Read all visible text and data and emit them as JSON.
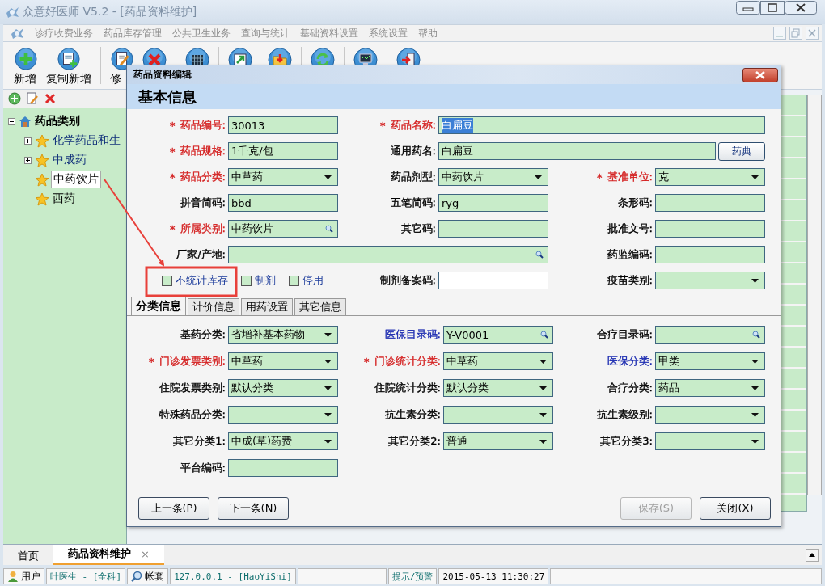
{
  "window": {
    "title": "众意好医师 V5.2 - [药品资料维护]"
  },
  "menu": [
    {
      "label": "诊疗收费业务"
    },
    {
      "label": "药品库存管理"
    },
    {
      "label": "公共卫生业务"
    },
    {
      "label": "查询与统计"
    },
    {
      "label": "基础资料设置"
    },
    {
      "label": "系统设置"
    },
    {
      "label": "帮助"
    }
  ],
  "toolbar": {
    "buttons": [
      {
        "label": "新增"
      },
      {
        "label": "复制新增"
      },
      {
        "label": "修"
      }
    ]
  },
  "tree": {
    "label": "药品类别",
    "expanded": true,
    "selected": false,
    "children": [
      {
        "label": "化学药品和生",
        "expanded": false,
        "selected": false
      },
      {
        "label": "中成药",
        "expanded": false,
        "selected": false
      },
      {
        "label": "中药饮片",
        "selected": true
      },
      {
        "label": "西药",
        "selected": false
      }
    ]
  },
  "dialog": {
    "title": "药品资料编辑",
    "section": "基本信息",
    "rows": [
      [
        {
          "mark": "*",
          "label": "药品编号:",
          "color": "#d42020",
          "kind": "text",
          "value": "30013"
        },
        {
          "mark": "*",
          "label": "药品名称:",
          "color": "#d42020",
          "kind": "text",
          "wide": true,
          "value": "白扁豆",
          "highlighted": true
        }
      ],
      [
        {
          "mark": "*",
          "label": "药品规格:",
          "color": "#d42020",
          "kind": "text",
          "value": "1千克/包"
        },
        {
          "label": "通用药名:",
          "kind": "text",
          "wide": true,
          "value": "白扁豆",
          "button": "药典"
        }
      ],
      [
        {
          "mark": "*",
          "label": "药品分类:",
          "color": "#d42020",
          "kind": "dropdown",
          "value": "中草药"
        },
        {
          "label": "药品剂型:",
          "kind": "dropdown",
          "value": "中药饮片"
        },
        {
          "mark": "*",
          "label": "基准单位:",
          "color": "#d42020",
          "kind": "dropdown",
          "value": "克"
        }
      ],
      [
        {
          "label": "拼音简码:",
          "kind": "text",
          "value": "bbd"
        },
        {
          "label": "五笔简码:",
          "kind": "text",
          "value": "ryg"
        },
        {
          "label": "条形码:",
          "kind": "text"
        }
      ],
      [
        {
          "mark": "*",
          "label": "所属类别:",
          "color": "#d42020",
          "kind": "lookup",
          "value": "中药饮片"
        },
        {
          "label": "其它码:",
          "kind": "text"
        },
        {
          "label": "批准文号:",
          "kind": "text"
        }
      ],
      [
        {
          "label": "厂家/产地:",
          "kind": "lookup",
          "wide": true
        },
        {
          "label": "药监编码:",
          "kind": "text"
        }
      ],
      [
        {
          "kind": "checks",
          "items": [
            {
              "label": "不统计库存",
              "checked": false
            },
            {
              "label": "制剂",
              "checked": false
            },
            {
              "label": "停用",
              "checked": false
            }
          ]
        },
        {
          "label": "制剂备案码:",
          "kind": "blank"
        },
        {
          "label": "疫苗类别:",
          "kind": "dropdown"
        }
      ]
    ],
    "tabs": [
      {
        "label": "分类信息",
        "selected": true
      },
      {
        "label": "计价信息",
        "selected": false
      },
      {
        "label": "用药设置",
        "selected": false
      },
      {
        "label": "其它信息",
        "selected": false
      }
    ],
    "tab_rows": [
      [
        {
          "label": "基药分类:",
          "kind": "dropdown",
          "value": "省增补基本药物"
        },
        {
          "label": "医保目录码:",
          "color": "#1a2ab0",
          "kind": "lookup",
          "value": "Y-V0001"
        },
        {
          "label": "合疗目录码:",
          "kind": "lookup"
        }
      ],
      [
        {
          "mark": "*",
          "label": "门诊发票类别:",
          "color": "#d42020",
          "kind": "dropdown",
          "value": "中草药"
        },
        {
          "mark": "*",
          "label": "门诊统计分类:",
          "color": "#d42020",
          "kind": "dropdown",
          "value": "中草药"
        },
        {
          "label": "医保分类:",
          "color": "#1a2ab0",
          "kind": "dropdown",
          "value": "甲类"
        }
      ],
      [
        {
          "label": "住院发票类别:",
          "kind": "dropdown",
          "value": "默认分类"
        },
        {
          "label": "住院统计分类:",
          "kind": "dropdown",
          "value": "默认分类"
        },
        {
          "label": "合疗分类:",
          "kind": "dropdown",
          "value": "药品"
        }
      ],
      [
        {
          "label": "特殊药品分类:",
          "kind": "dropdown"
        },
        {
          "label": "抗生素分类:",
          "kind": "dropdown"
        },
        {
          "label": "抗生素级别:",
          "kind": "dropdown"
        }
      ],
      [
        {
          "label": "其它分类1:",
          "kind": "dropdown",
          "value": "中成(草)药费"
        },
        {
          "label": "其它分类2:",
          "kind": "dropdown",
          "value": "普通"
        },
        {
          "label": "其它分类3:",
          "kind": "dropdown"
        }
      ],
      [
        {
          "label": "平台编码:",
          "kind": "text"
        }
      ]
    ],
    "nav_buttons": [
      {
        "label": "上一条(P)",
        "disabled": false
      },
      {
        "label": "下一条(N)",
        "disabled": false
      }
    ],
    "action_buttons": [
      {
        "label": "保存(S)",
        "disabled": true
      },
      {
        "label": "关闭(X)",
        "disabled": false
      }
    ]
  },
  "bottom_tabs": [
    {
      "label": "首页",
      "selected": false
    },
    {
      "label": "药品资料维护",
      "selected": true,
      "close": "×"
    }
  ],
  "status_bar": [
    {
      "kind": "button",
      "text": "用户"
    },
    {
      "kind": "value",
      "text": "叶医生 - [全科]"
    },
    {
      "kind": "button",
      "text": "帐套"
    },
    {
      "kind": "value",
      "text": "127.0.0.1 - [HaoYiShi]"
    },
    {
      "kind": "empty"
    },
    {
      "kind": "value",
      "text": "提示/预警"
    },
    {
      "kind": "plain",
      "text": "2015-05-13 11:30:27"
    },
    {
      "kind": "empty"
    }
  ]
}
